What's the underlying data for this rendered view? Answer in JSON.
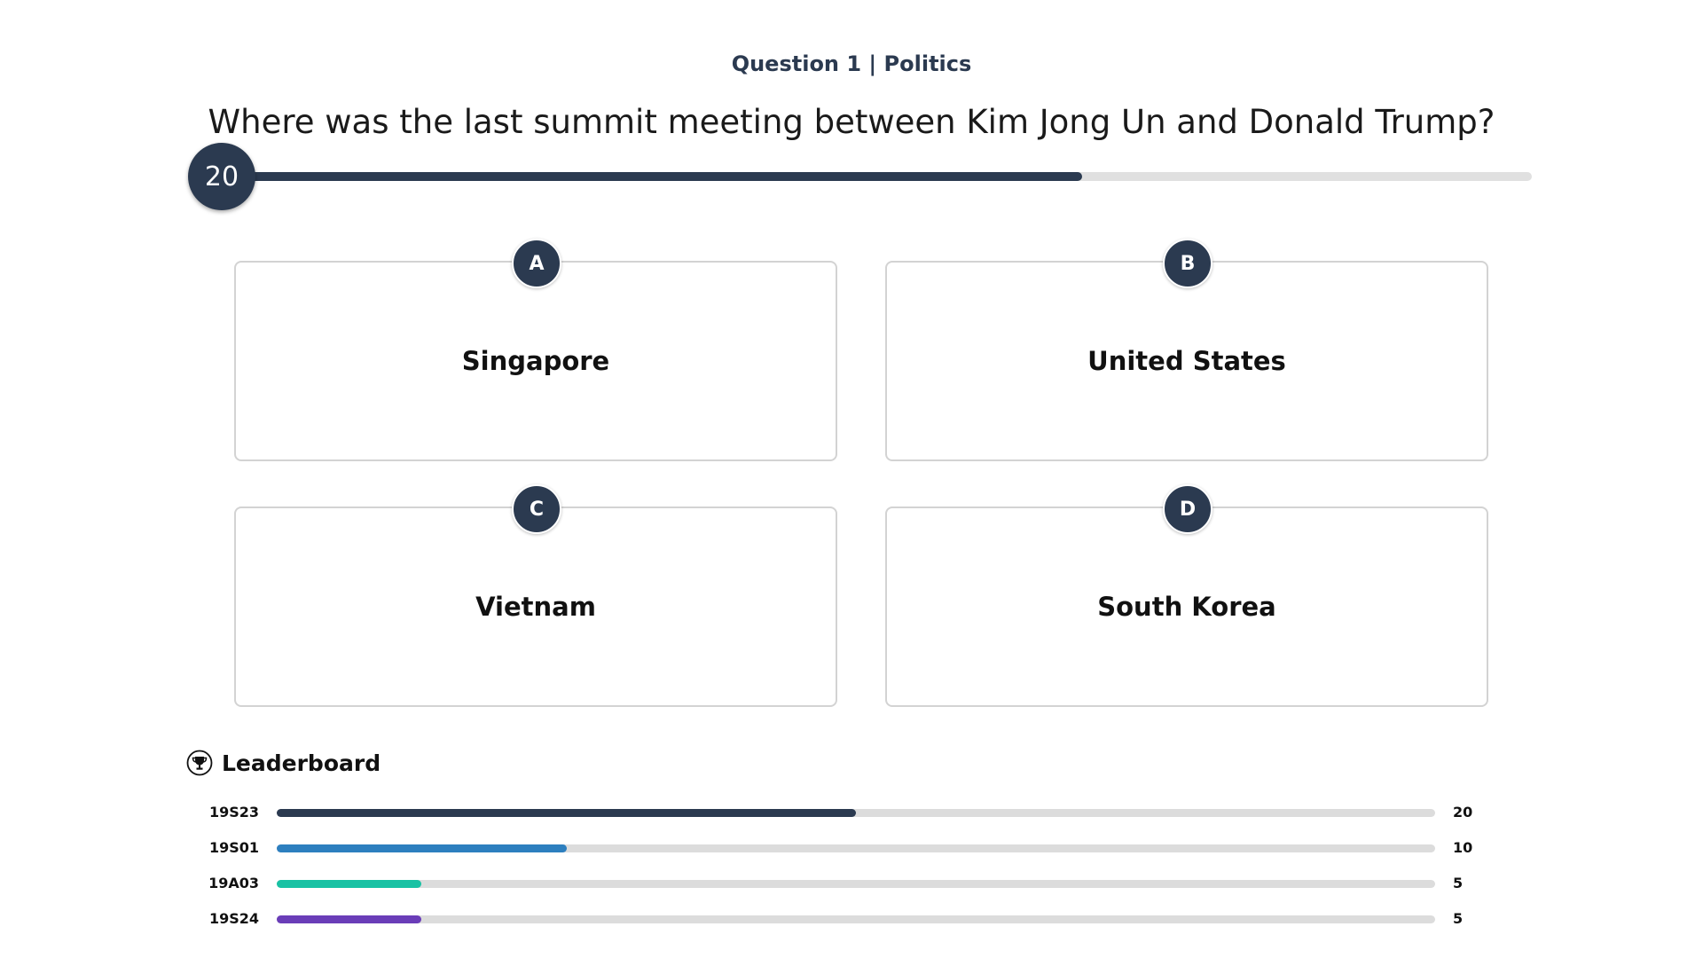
{
  "question": {
    "meta": "Question 1 | Politics",
    "text": "Where was the last summit meeting between Kim Jong Un and Donald Trump?"
  },
  "timer": {
    "seconds_label": "20",
    "progress_fraction": 0.657,
    "color": "#2b3a50"
  },
  "answers": [
    {
      "letter": "A",
      "label": "Singapore"
    },
    {
      "letter": "B",
      "label": "United States"
    },
    {
      "letter": "C",
      "label": "Vietnam"
    },
    {
      "letter": "D",
      "label": "South Korea"
    }
  ],
  "leaderboard": {
    "title": "Leaderboard",
    "icon": "trophy-icon",
    "max_score": 40,
    "rows": [
      {
        "name": "19S23",
        "score": 20,
        "color": "#2b3a50"
      },
      {
        "name": "19S01",
        "score": 10,
        "color": "#2d7fbf"
      },
      {
        "name": "19A03",
        "score": 5,
        "color": "#19c2a4"
      },
      {
        "name": "19S24",
        "score": 5,
        "color": "#6a3db8"
      }
    ]
  }
}
